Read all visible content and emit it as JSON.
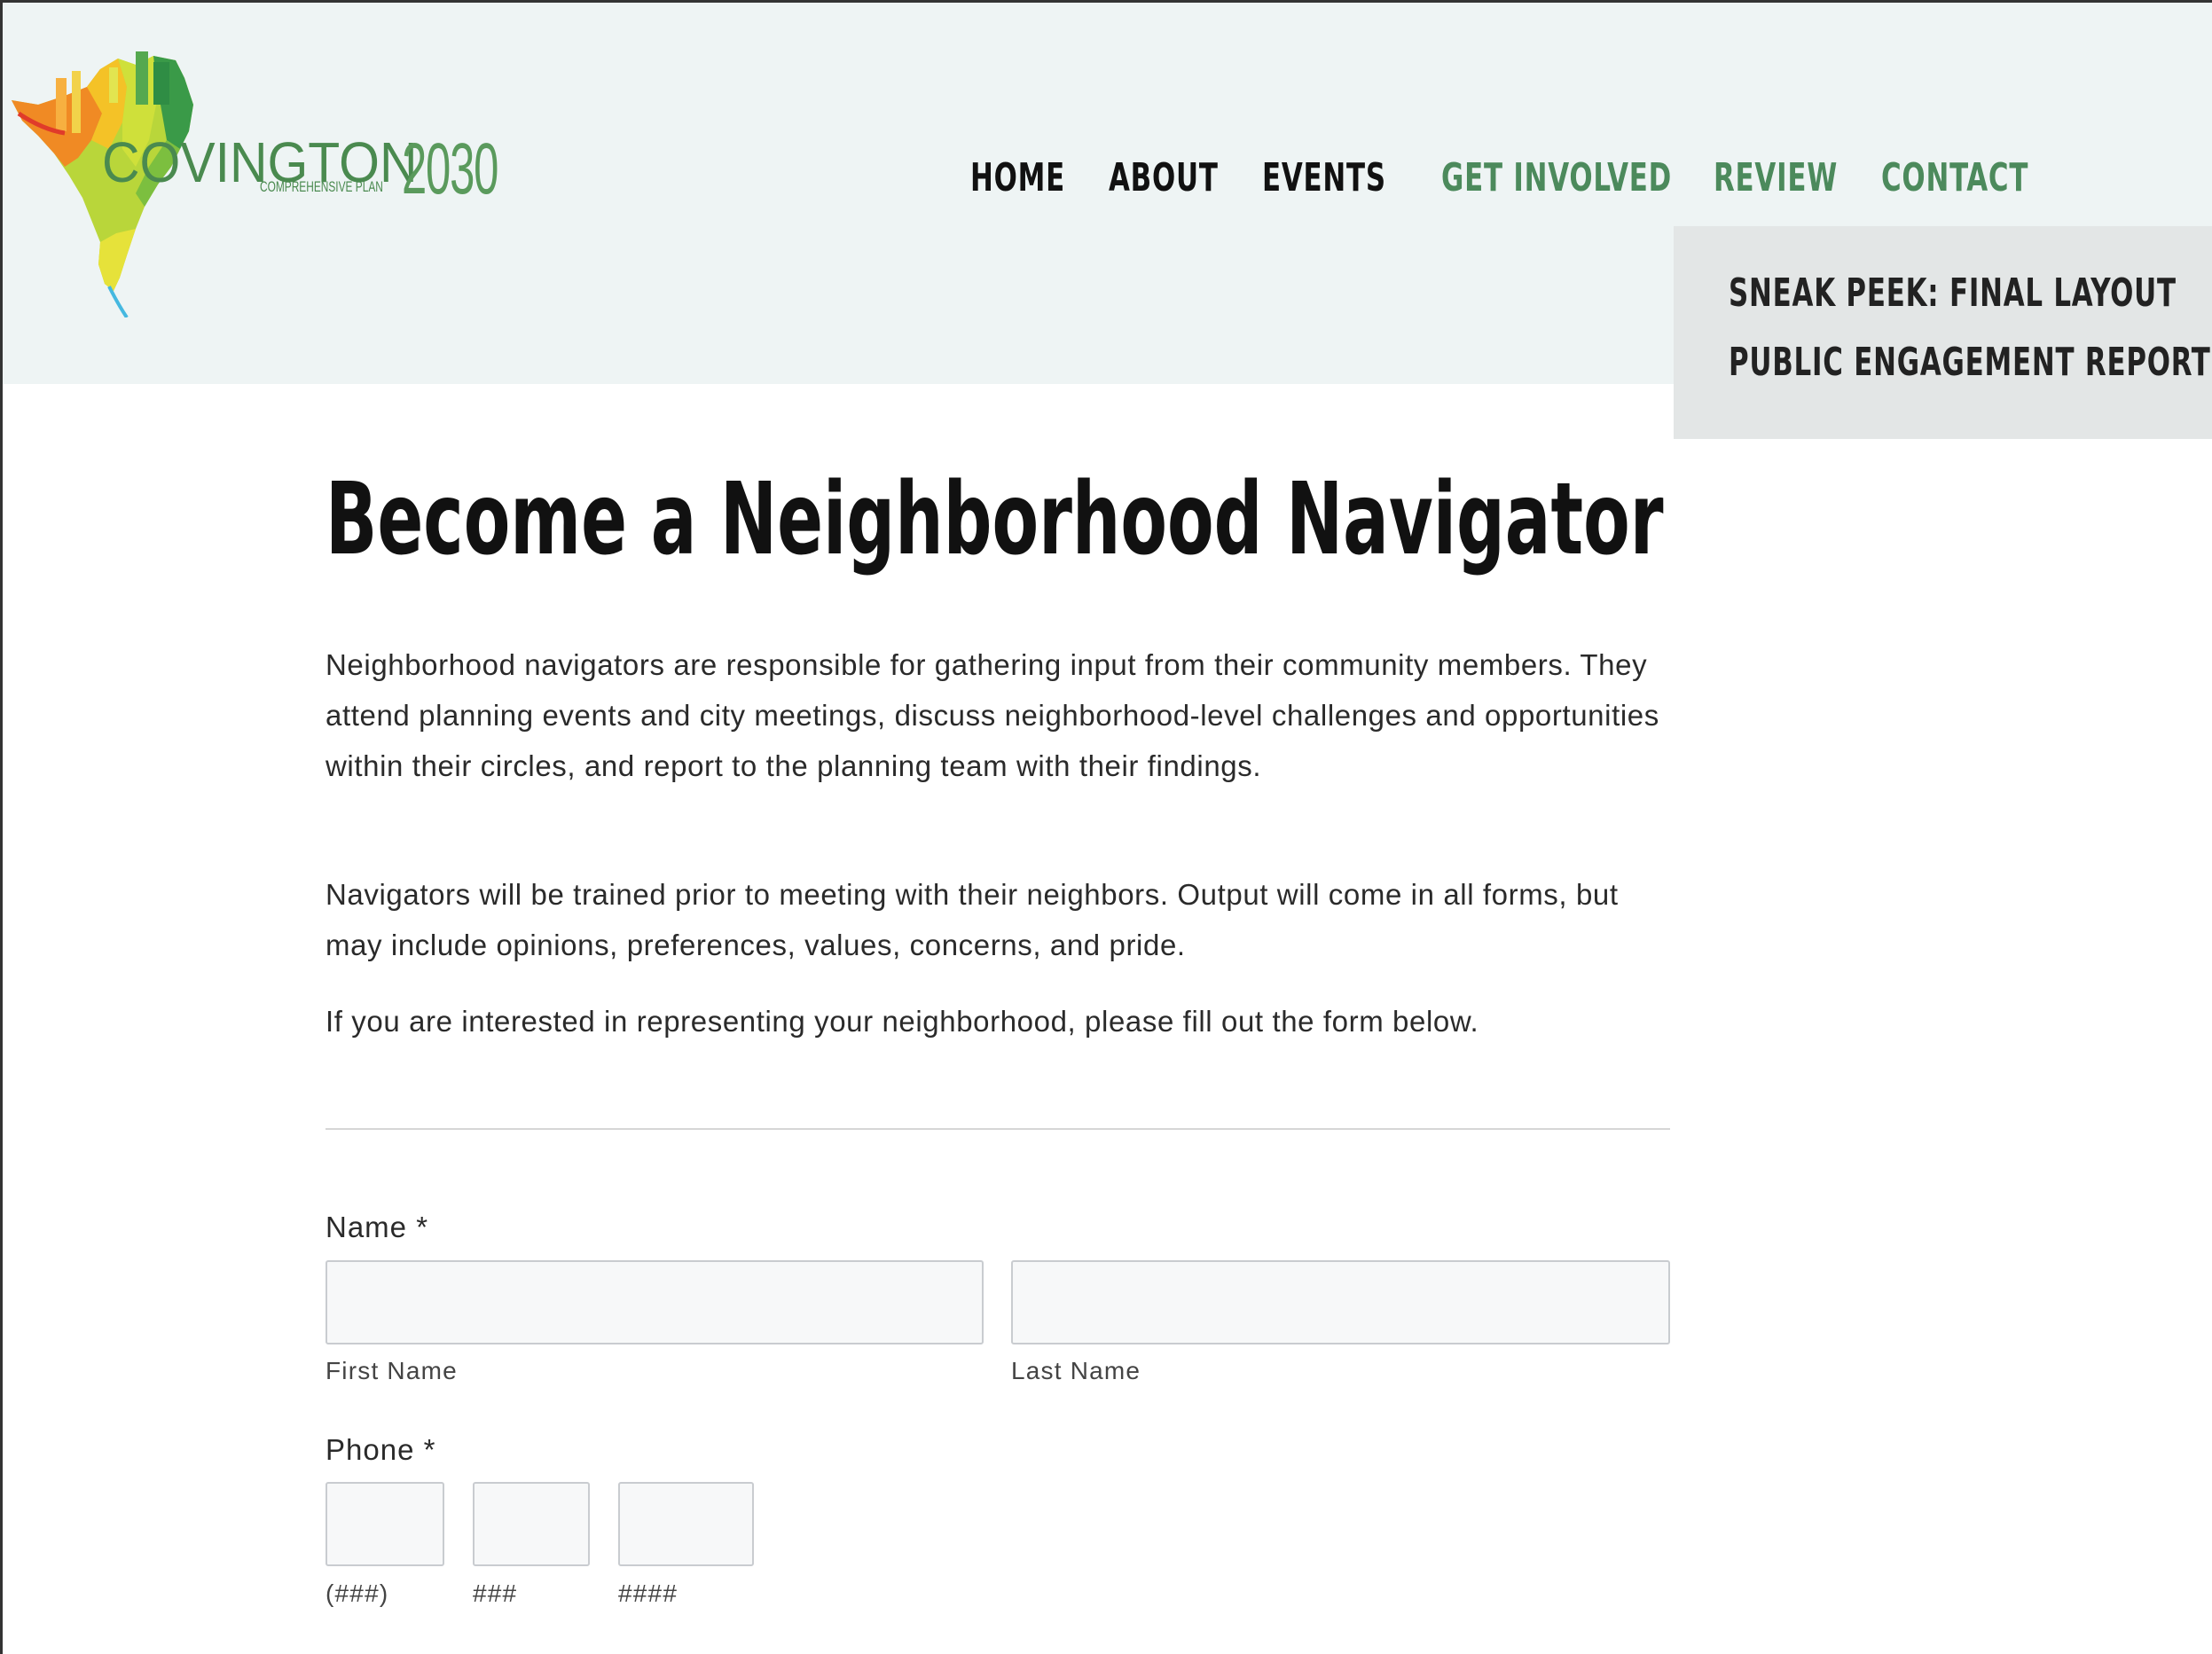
{
  "logo": {
    "word": "COVINGTON",
    "year": "2030",
    "subtitle": "COMPREHENSIVE PLAN"
  },
  "nav": {
    "items": [
      "HOME",
      "ABOUT",
      "EVENTS",
      "GET INVOLVED",
      "REVIEW",
      "CONTACT"
    ],
    "dropdown": [
      "SNEAK PEEK: FINAL LAYOUT",
      "PUBLIC ENGAGEMENT REPORT"
    ]
  },
  "page": {
    "title": "Become a Neighborhood Navigator",
    "paragraphs": [
      "Neighborhood navigators are responsible for gathering input from their community members. They attend planning events and city meetings, discuss neighborhood-level challenges and opportunities within their circles, and report to the planning team with their findings.",
      "Navigators will be trained prior to meeting with their neighbors. Output will come in all forms, but may include opinions, preferences, values, concerns, and pride.",
      "If you are interested in representing your neighborhood, please fill out the form below."
    ]
  },
  "form": {
    "name_label": "Name *",
    "first_name_label": "First Name",
    "last_name_label": "Last Name",
    "first_name_value": "",
    "last_name_value": "",
    "phone_label": "Phone *",
    "phone_area_label": "(###)",
    "phone_prefix_label": "###",
    "phone_line_label": "####",
    "phone_area_value": "",
    "phone_prefix_value": "",
    "phone_line_value": ""
  },
  "colors": {
    "header_bg": "#eef4f4",
    "nav_accent": "#4c8a5c",
    "dropdown_bg": "#e3e6e6"
  }
}
